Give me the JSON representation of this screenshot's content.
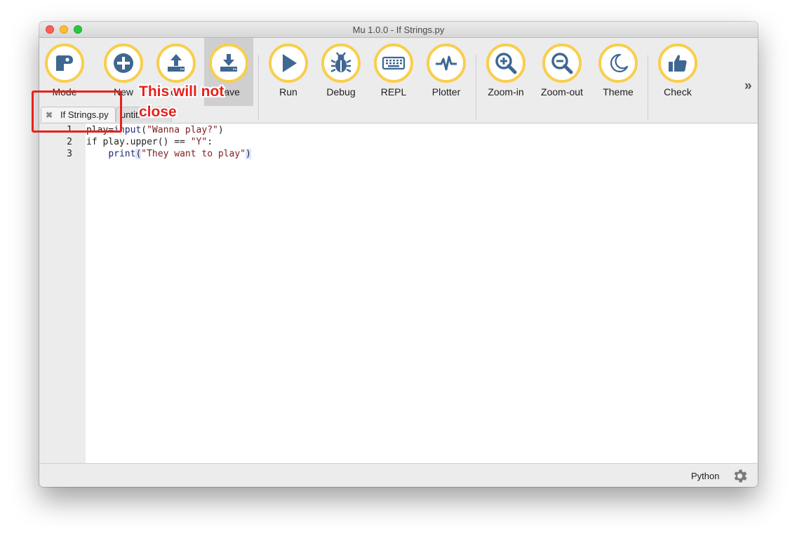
{
  "window": {
    "title": "Mu 1.0.0 - If Strings.py"
  },
  "toolbar": {
    "buttons": [
      {
        "label": "Mode",
        "icon": "mode-icon"
      },
      {
        "label": "New",
        "icon": "plus-icon"
      },
      {
        "label": "Load",
        "icon": "upload-icon"
      },
      {
        "label": "Save",
        "icon": "download-icon"
      },
      {
        "label": "Run",
        "icon": "play-icon"
      },
      {
        "label": "Debug",
        "icon": "bug-icon"
      },
      {
        "label": "REPL",
        "icon": "keyboard-icon"
      },
      {
        "label": "Plotter",
        "icon": "pulse-icon"
      },
      {
        "label": "Zoom-in",
        "icon": "zoom-in-icon"
      },
      {
        "label": "Zoom-out",
        "icon": "zoom-out-icon"
      },
      {
        "label": "Theme",
        "icon": "moon-icon"
      },
      {
        "label": "Check",
        "icon": "thumbs-up-icon"
      }
    ],
    "more": "»",
    "accent": "#f9ce4c",
    "icon_color": "#3e6792"
  },
  "tabs": [
    {
      "label": "If Strings.py",
      "close": "✖",
      "active": true
    },
    {
      "label": "untitled",
      "active": false
    }
  ],
  "editor": {
    "line_numbers": [
      "1",
      "2",
      "3"
    ],
    "lines": [
      "play=input(\"Wanna play?\")",
      "if play.upper() == \"Y\":",
      "    print(\"They want to play\")"
    ]
  },
  "annotation": {
    "line1": "This will not",
    "line2": "close",
    "color": "#e8211b"
  },
  "statusbar": {
    "mode": "Python",
    "icon": "gear-icon"
  }
}
